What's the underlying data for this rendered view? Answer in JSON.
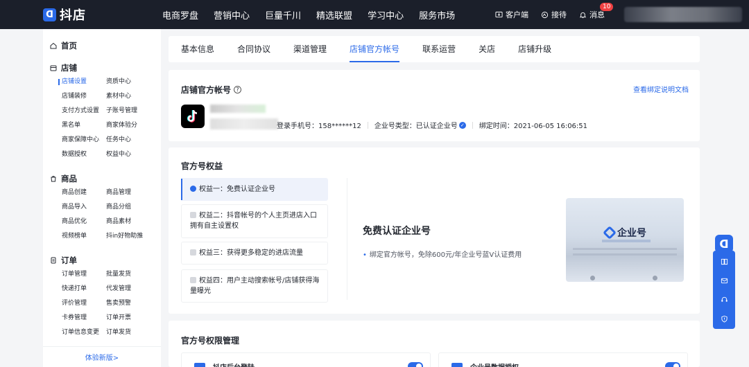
{
  "app": {
    "logo_glyph": "ᗡ",
    "name": "抖店"
  },
  "topnav": [
    "电商罗盘",
    "营销中心",
    "巨量千川",
    "精选联盟",
    "学习中心",
    "服务市场"
  ],
  "topright": {
    "client": "客户端",
    "reception": "接待",
    "messages": "消息",
    "msg_count": "10"
  },
  "sidebar": {
    "groups": [
      {
        "title": "首页",
        "icon": "home-icon",
        "items": []
      },
      {
        "title": "店铺",
        "icon": "store-icon",
        "items": [
          "店铺设置",
          "资质中心",
          "店铺装修",
          "素材中心",
          "支付方式设置",
          "子账号管理",
          "黑名单",
          "商家体验分",
          "商家保障中心",
          "任务中心",
          "数据授权",
          "权益中心"
        ]
      },
      {
        "title": "商品",
        "icon": "goods-icon",
        "items": [
          "商品创建",
          "商品管理",
          "商品导入",
          "商品分组",
          "商品优化",
          "商品素材",
          "视频榜单",
          "抖in好物助推"
        ]
      },
      {
        "title": "订单",
        "icon": "order-icon",
        "items": [
          "订单管理",
          "批量发货",
          "快递打单",
          "代发管理",
          "评价管理",
          "售卖预警",
          "卡券管理",
          "订单开票",
          "订单信息变更",
          "订单发货"
        ]
      }
    ],
    "active_item": "店铺设置",
    "footer": "体验新版>"
  },
  "tabs": {
    "items": [
      "基本信息",
      "合同协议",
      "渠道管理",
      "店铺官方帐号",
      "联系运营",
      "关店",
      "店铺升级"
    ],
    "active": "店铺官方帐号"
  },
  "account": {
    "title": "店铺官方帐号",
    "help": "?",
    "doc_link": "查看绑定说明文档",
    "phone": "登录手机号：158******12",
    "type": "企业号类型：已认证企业号",
    "bind_time": "绑定时间：2021-06-05 16:06:51"
  },
  "benefits": {
    "title": "官方号权益",
    "items": [
      "权益一：免费认证企业号",
      "权益二：抖音帐号的个人主页进店入口拥有自主设置权",
      "权益三：获得更多稳定的进店流量",
      "权益四：用户主动搜索帐号/店铺获得海量曝光"
    ],
    "heading": "免费认证企业号",
    "desc": "绑定官方帐号，免除600元/年企业号蓝V认证费用",
    "image_brand": "企业号"
  },
  "permissions": {
    "title": "官方号权限管理",
    "items": [
      "抖店后台登陆",
      "企业号数据授权"
    ]
  },
  "colors": {
    "accent": "#2b6ae8",
    "topbar": "#1b1f2a",
    "badge": "#f04142"
  }
}
